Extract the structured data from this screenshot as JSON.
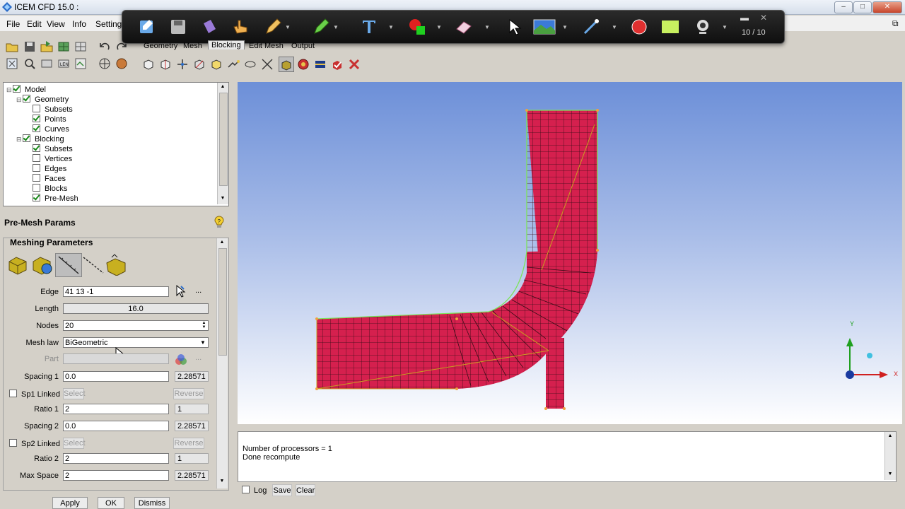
{
  "window": {
    "title": "ICEM CFD 15.0 :",
    "controls": [
      "–",
      "□",
      "✕"
    ]
  },
  "menu": {
    "items": [
      "File",
      "Edit",
      "View",
      "Info",
      "Settings"
    ]
  },
  "recorder": {
    "counter": "10 / 10"
  },
  "tabs": {
    "items": [
      "Geometry",
      "Mesh",
      "Blocking",
      "Edit Mesh",
      "Output"
    ],
    "active": "Blocking"
  },
  "tree": {
    "items": [
      {
        "label": "Model",
        "level": 0,
        "checked": true
      },
      {
        "label": "Geometry",
        "level": 1,
        "checked": true
      },
      {
        "label": "Subsets",
        "level": 2,
        "checked": false
      },
      {
        "label": "Points",
        "level": 2,
        "checked": true
      },
      {
        "label": "Curves",
        "level": 2,
        "checked": true
      },
      {
        "label": "Blocking",
        "level": 1,
        "checked": true
      },
      {
        "label": "Subsets",
        "level": 2,
        "checked": true
      },
      {
        "label": "Vertices",
        "level": 2,
        "checked": false
      },
      {
        "label": "Edges",
        "level": 2,
        "checked": false
      },
      {
        "label": "Faces",
        "level": 2,
        "checked": false
      },
      {
        "label": "Blocks",
        "level": 2,
        "checked": false
      },
      {
        "label": "Pre-Mesh",
        "level": 2,
        "checked": true
      }
    ]
  },
  "params": {
    "title": "Pre-Mesh Params",
    "section_title": "Meshing Parameters",
    "edge_label": "Edge",
    "edge_value": "41 13 -1",
    "length_label": "Length",
    "length_value": "16.0",
    "nodes_label": "Nodes",
    "nodes_value": "20",
    "meshlaw_label": "Mesh law",
    "meshlaw_value": "BiGeometric",
    "part_label": "Part",
    "spacing1_label": "Spacing 1",
    "spacing1_value": "0.0",
    "spacing1_actual": "2.28571",
    "sp1linked_label": "Sp1 Linked",
    "select_label": "Select",
    "reverse_label": "Reverse",
    "ratio1_label": "Ratio 1",
    "ratio1_value": "2",
    "ratio1_actual": "1",
    "spacing2_label": "Spacing 2",
    "spacing2_value": "0.0",
    "spacing2_actual": "2.28571",
    "sp2linked_label": "Sp2 Linked",
    "ratio2_label": "Ratio 2",
    "ratio2_value": "2",
    "ratio2_actual": "1",
    "maxspace_label": "Max Space",
    "maxspace_value": "2",
    "maxspace_actual": "2.28571",
    "dots": "...",
    "apply_label": "Apply",
    "ok_label": "OK",
    "dismiss_label": "Dismiss"
  },
  "console": {
    "lines": [
      "Number of processors = 1",
      "Done recompute"
    ],
    "log_label": "Log",
    "save_label": "Save",
    "clear_label": "Clear"
  },
  "axes": {
    "x": "X",
    "y": "Y"
  },
  "colors": {
    "mesh_fill": "#d5204e",
    "mesh_lines": "#3a0d18",
    "edge_curve": "#7ce35a",
    "bg_top": "#6c8fd8"
  }
}
